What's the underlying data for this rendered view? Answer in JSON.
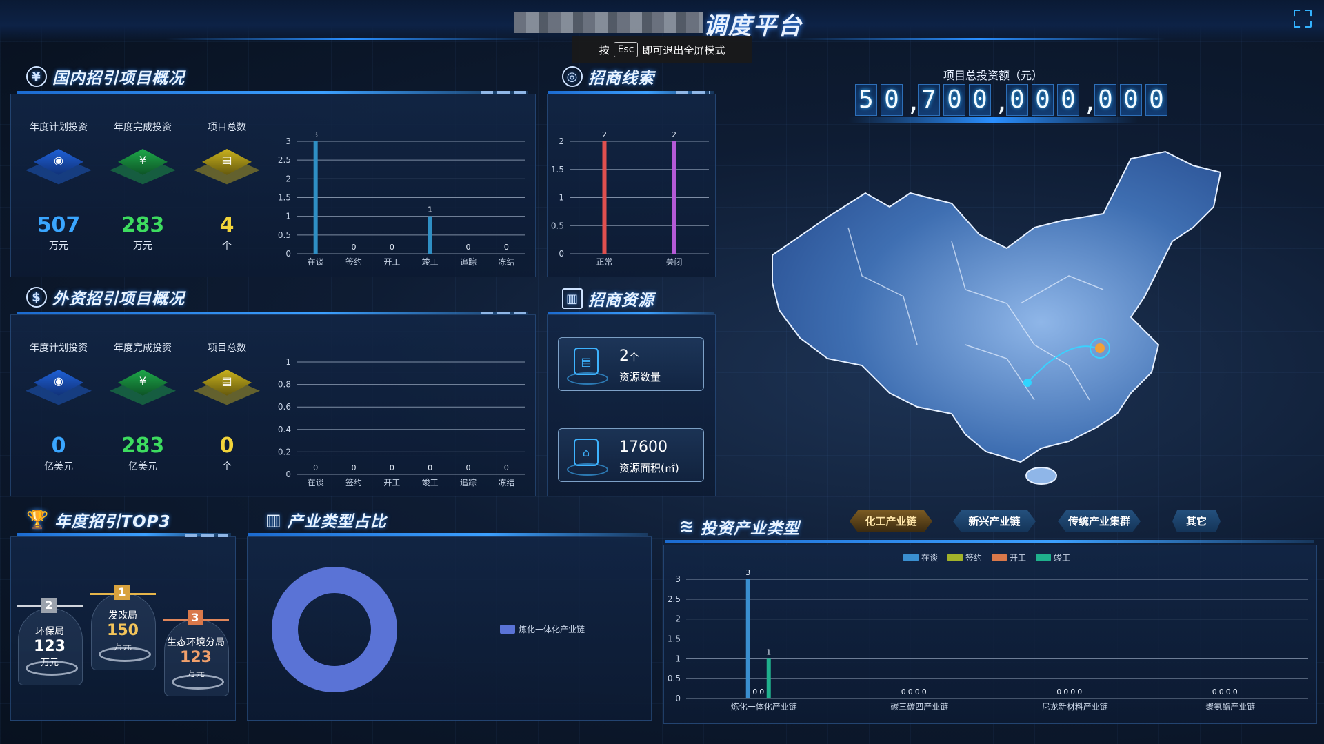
{
  "header": {
    "title": "调度平台",
    "esc_prefix": "按",
    "esc_key": "Esc",
    "esc_suffix": "即可退出全屏模式"
  },
  "domestic": {
    "title": "国内招引项目概况",
    "stats": [
      {
        "label": "年度计划投资",
        "value": "507",
        "unit": "万元",
        "color": "#3aa6ff"
      },
      {
        "label": "年度完成投资",
        "value": "283",
        "unit": "万元",
        "color": "#3ddc5f"
      },
      {
        "label": "项目总数",
        "value": "4",
        "unit": "个",
        "color": "#f2d43a"
      }
    ],
    "chart_data": {
      "type": "bar",
      "categories": [
        "在谈",
        "签约",
        "开工",
        "竣工",
        "追踪",
        "冻结"
      ],
      "values": [
        3,
        0,
        0,
        1,
        0,
        0
      ],
      "ylim": [
        0,
        3
      ],
      "yticks": [
        "0",
        "0.5",
        "1",
        "1.5",
        "2",
        "2.5",
        "3"
      ]
    }
  },
  "leads": {
    "title": "招商线索",
    "chart_data": {
      "type": "bar",
      "categories": [
        "正常",
        "关闭"
      ],
      "values": [
        2,
        2
      ],
      "colors": [
        "#e0504f",
        "#b45ad6"
      ],
      "ylim": [
        0,
        2
      ],
      "yticks": [
        "0",
        "0.5",
        "1",
        "1.5",
        "2"
      ]
    }
  },
  "foreign": {
    "title": "外资招引项目概况",
    "stats": [
      {
        "label": "年度计划投资",
        "value": "0",
        "unit": "亿美元",
        "color": "#3aa6ff"
      },
      {
        "label": "年度完成投资",
        "value": "283",
        "unit": "亿美元",
        "color": "#3ddc5f"
      },
      {
        "label": "项目总数",
        "value": "0",
        "unit": "个",
        "color": "#f2d43a"
      }
    ],
    "chart_data": {
      "type": "bar",
      "categories": [
        "在谈",
        "签约",
        "开工",
        "竣工",
        "追踪",
        "冻结"
      ],
      "values": [
        0,
        0,
        0,
        0,
        0,
        0
      ],
      "ylim": [
        0,
        1
      ],
      "yticks": [
        "0",
        "0.2",
        "0.4",
        "0.6",
        "0.8",
        "1"
      ]
    }
  },
  "resources": {
    "title": "招商资源",
    "items": [
      {
        "num": "2",
        "unit": "个",
        "label": "资源数量",
        "icon": "document-icon"
      },
      {
        "num": "17600",
        "unit": "",
        "label": "资源面积(㎡)",
        "icon": "house-icon"
      }
    ]
  },
  "investment_total": {
    "label": "项目总投资额（元）",
    "digits": [
      "5",
      "0",
      ",",
      "7",
      "0",
      "0",
      ",",
      "0",
      "0",
      "0",
      ",",
      "0",
      "0",
      "0"
    ]
  },
  "top3": {
    "title": "年度招引TOP3",
    "items": [
      {
        "rank": "2",
        "name": "环保局",
        "value": "123",
        "unit": "万元",
        "color": "#ffffff"
      },
      {
        "rank": "1",
        "name": "发改局",
        "value": "150",
        "unit": "万元",
        "color": "#f3c45a"
      },
      {
        "rank": "3",
        "name": "生态环境分局",
        "value": "123",
        "unit": "万元",
        "color": "#f2a06b"
      }
    ]
  },
  "industry_share": {
    "title": "产业类型占比",
    "chart_data": {
      "type": "pie",
      "labels": [
        "炼化一体化产业链"
      ],
      "values": [
        100
      ],
      "colors": [
        "#5a73d6"
      ]
    }
  },
  "invest_industry": {
    "title": "投资产业类型",
    "tabs": [
      "化工产业链",
      "新兴产业链",
      "传统产业集群",
      "其它"
    ],
    "active_tab": 0,
    "chart_data": {
      "type": "bar",
      "categories": [
        "炼化一体化产业链",
        "碳三碳四产业链",
        "尼龙新材料产业链",
        "聚氨酯产业链"
      ],
      "series": [
        {
          "name": "在谈",
          "values": [
            3,
            0,
            0,
            0
          ],
          "color": "#3a8fd0"
        },
        {
          "name": "签约",
          "values": [
            0,
            0,
            0,
            0
          ],
          "color": "#a2b22a"
        },
        {
          "name": "开工",
          "values": [
            0,
            0,
            0,
            0
          ],
          "color": "#d9784a"
        },
        {
          "name": "竣工",
          "values": [
            1,
            0,
            0,
            0
          ],
          "color": "#1fb08c"
        }
      ],
      "ylim": [
        0,
        3
      ],
      "yticks": [
        "0",
        "0.5",
        "1",
        "1.5",
        "2",
        "2.5",
        "3"
      ]
    }
  }
}
